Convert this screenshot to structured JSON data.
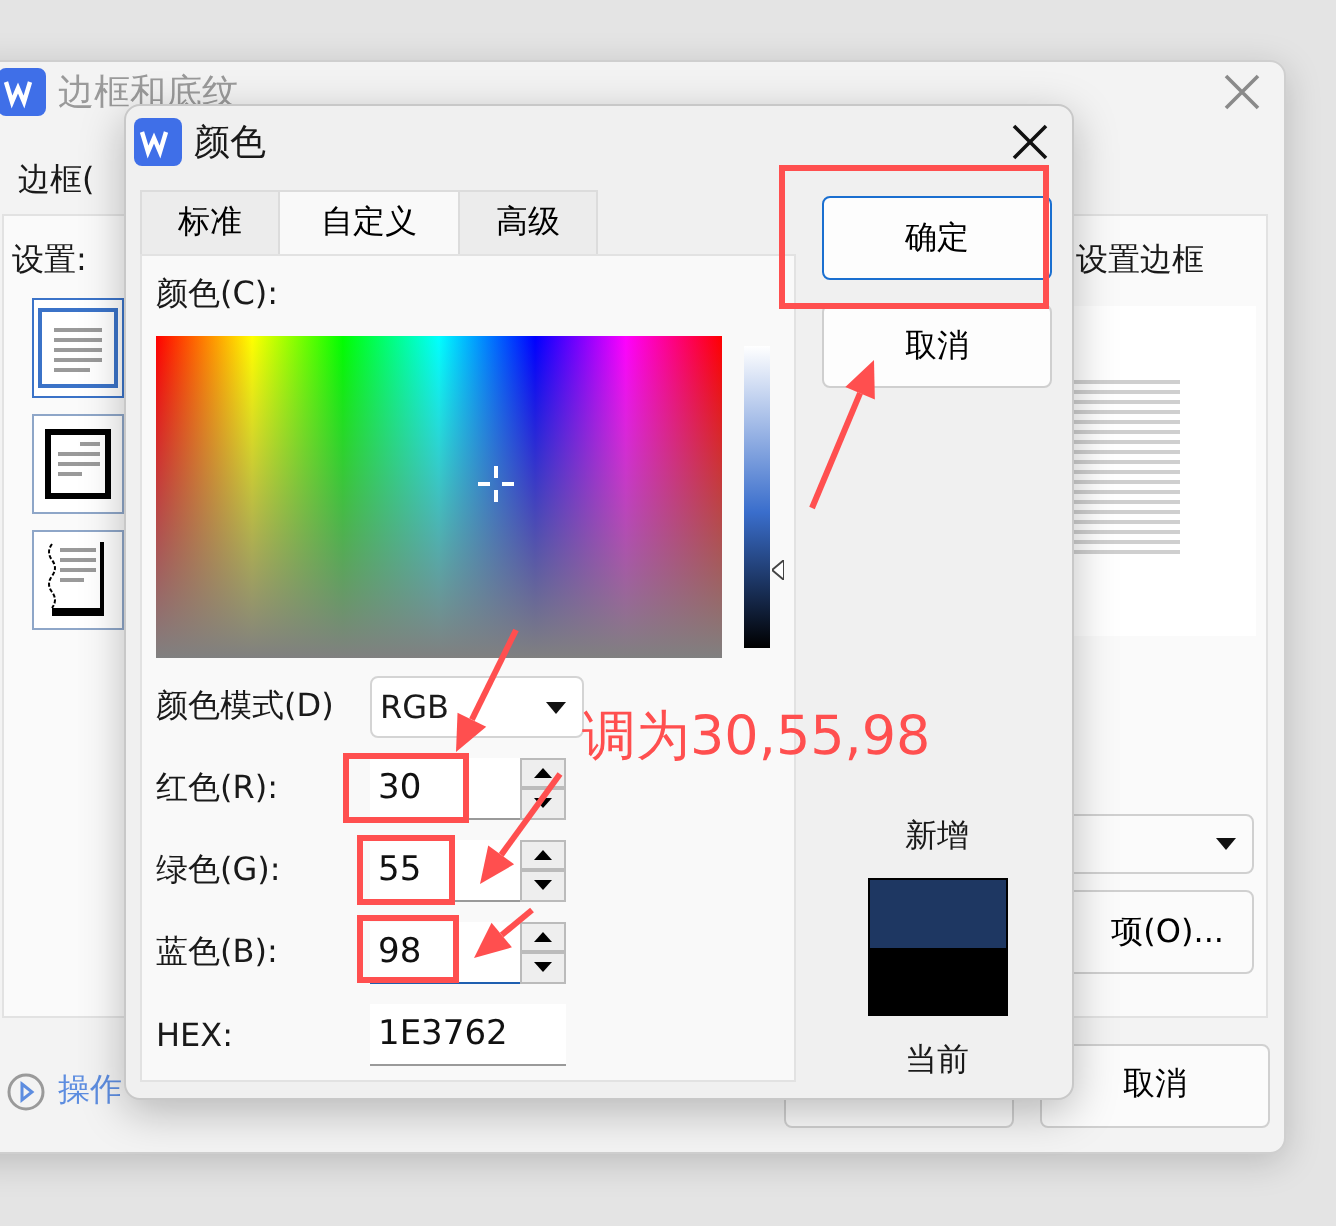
{
  "background_window": {
    "title": "边框和底纹",
    "tab": "边框(",
    "settings_label": "设置:",
    "settings": [
      {
        "kind": "none",
        "selected": true
      },
      {
        "kind": "box",
        "selected": false
      },
      {
        "kind": "shadow",
        "selected": false
      }
    ],
    "preview_label": "设置边框",
    "options_button": "项(O)...",
    "cancel_button": "取消",
    "tips_link": "操作"
  },
  "color_dialog": {
    "title": "颜色",
    "tabs": [
      {
        "label": "标准",
        "selected": false
      },
      {
        "label": "自定义",
        "selected": true
      },
      {
        "label": "高级",
        "selected": false
      }
    ],
    "color_label": "颜色(C):",
    "brightness": {
      "level": 0.26
    },
    "mode": {
      "label": "颜色模式(D)",
      "value": "RGB"
    },
    "channels": [
      {
        "label": "红色(R):",
        "value": "30",
        "focused": false
      },
      {
        "label": "绿色(G):",
        "value": "55",
        "focused": false
      },
      {
        "label": "蓝色(B):",
        "value": "98",
        "focused": true
      }
    ],
    "hex": {
      "label": "HEX:",
      "value": "1E3762"
    },
    "ok_button": "确定",
    "cancel_button": "取消",
    "new_label": "新增",
    "current_label": "当前"
  },
  "annotation": {
    "text": "调为30,55,98"
  }
}
